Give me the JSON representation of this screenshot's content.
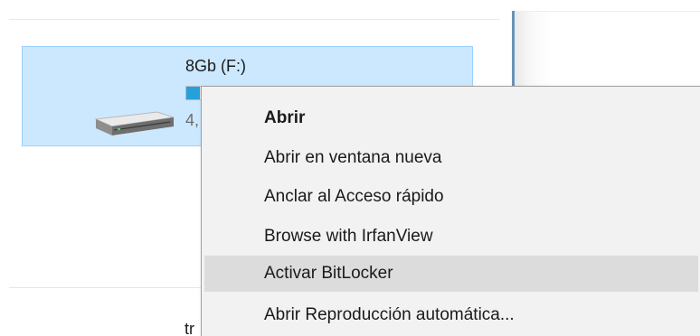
{
  "drive": {
    "name": "8Gb (F:)",
    "free_text": "4,",
    "used_fraction": 0.05,
    "icon": "hard-drive-icon"
  },
  "background_text": "tr",
  "context_menu": {
    "items": [
      {
        "label": "Abrir",
        "default": true
      },
      {
        "label": "Abrir en ventana nueva"
      },
      {
        "label": "Anclar al Acceso rápido"
      },
      {
        "label": "Browse with IrfanView"
      },
      {
        "label": "Activar BitLocker",
        "highlighted": true
      },
      {
        "label": "Abrir Reproducción automática..."
      }
    ]
  },
  "colors": {
    "selection_fill": "#cce8ff",
    "selection_border": "#99d1ff",
    "capacity_bar": "#26a0da",
    "menu_background": "#f2f2f2",
    "menu_hover": "#dcdcdc"
  }
}
